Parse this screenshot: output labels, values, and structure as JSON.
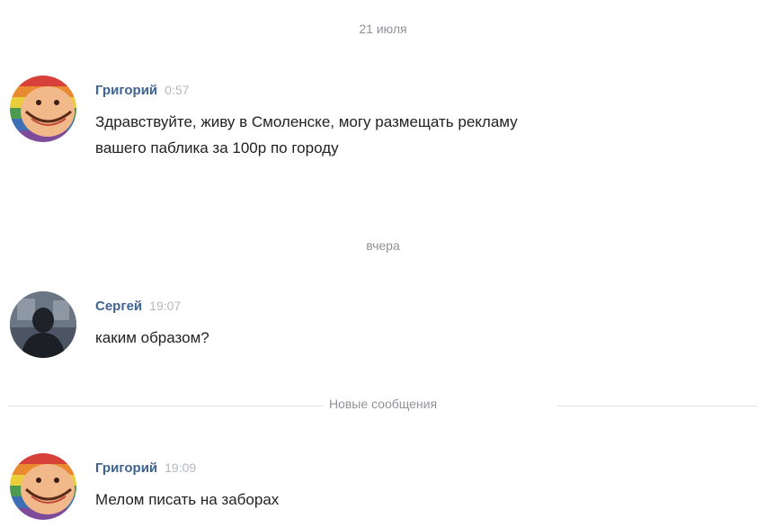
{
  "dates": {
    "first": "21 июля",
    "second": "вчера"
  },
  "new_messages_label": "Новые сообщения",
  "messages": [
    {
      "author": "Григорий",
      "time": "0:57",
      "lines": [
        "Здравствуйте, живу в Смоленске, могу размещать рекламу",
        "вашего паблика за 100р по городу"
      ],
      "avatar": "rainbow-smile-avatar"
    },
    {
      "author": "Сергей",
      "time": "19:07",
      "lines": [
        "каким образом?"
      ],
      "avatar": "person-silhouette-avatar"
    },
    {
      "author": "Григорий",
      "time": "19:09",
      "lines": [
        "Мелом писать на заборах"
      ],
      "avatar": "rainbow-smile-avatar"
    }
  ],
  "colors": {
    "author": "#3f6391",
    "time": "#b4b8bd",
    "separator_text": "#8f9399",
    "separator_line": "#dfe3e8"
  }
}
